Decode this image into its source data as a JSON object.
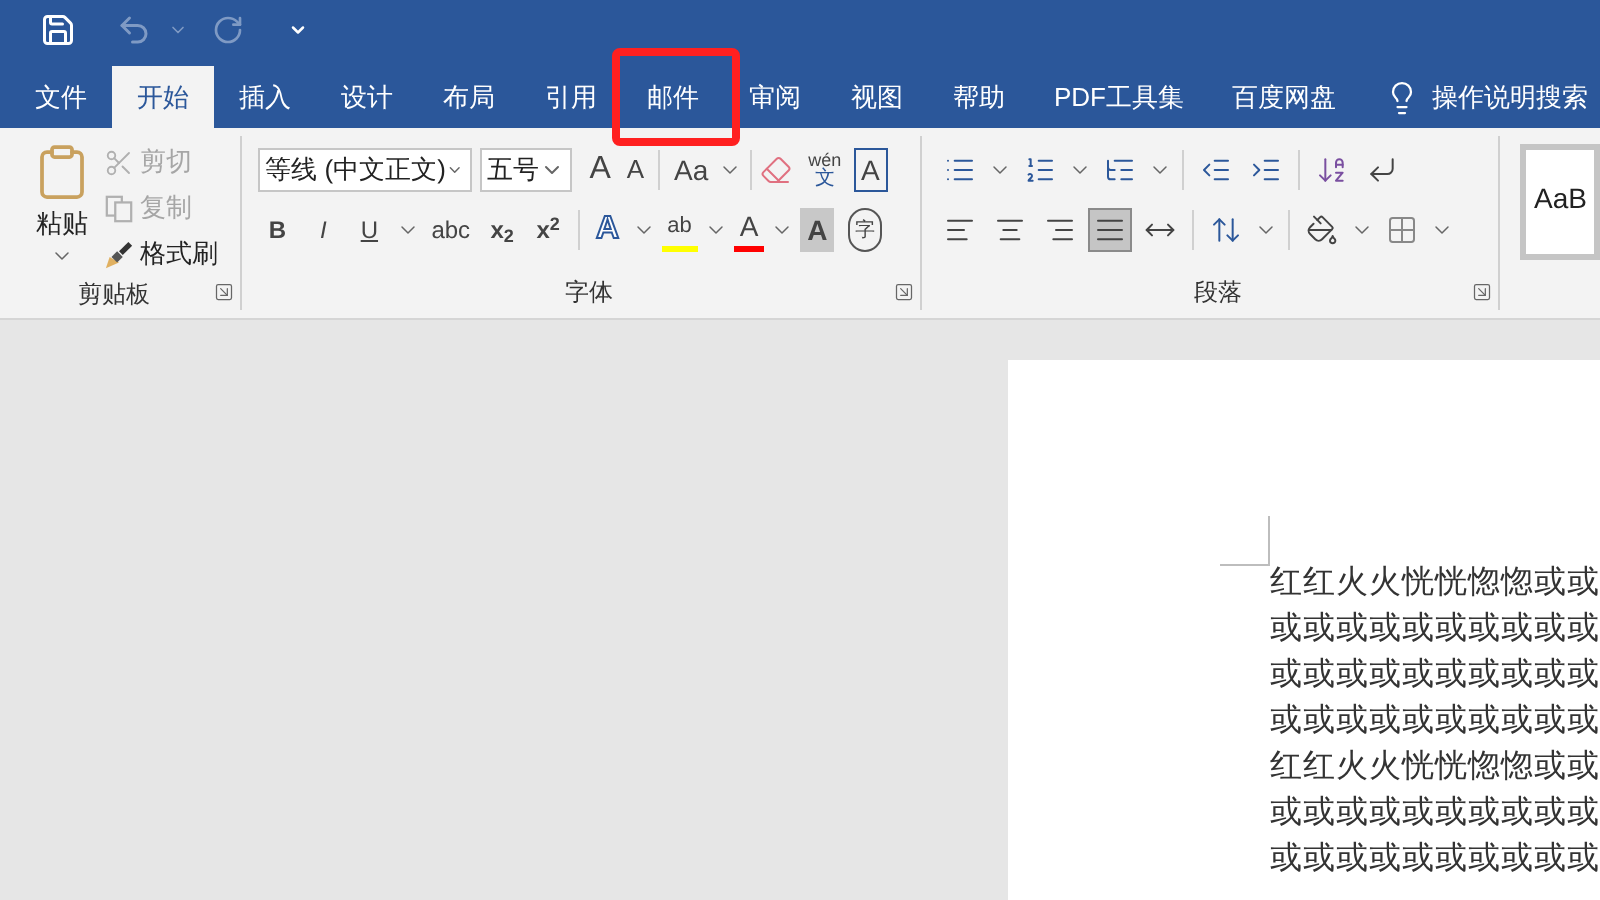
{
  "tabs": [
    {
      "label": "文件",
      "selected": false
    },
    {
      "label": "开始",
      "selected": true
    },
    {
      "label": "插入",
      "selected": false
    },
    {
      "label": "设计",
      "selected": false
    },
    {
      "label": "布局",
      "selected": false
    },
    {
      "label": "引用",
      "selected": false
    },
    {
      "label": "邮件",
      "selected": false
    },
    {
      "label": "审阅",
      "selected": false
    },
    {
      "label": "视图",
      "selected": false
    },
    {
      "label": "帮助",
      "selected": false
    },
    {
      "label": "PDF工具集",
      "selected": false
    },
    {
      "label": "百度网盘",
      "selected": false
    }
  ],
  "search": {
    "label": "操作说明搜索"
  },
  "clipboard": {
    "paste": "粘贴",
    "cut": {
      "label": "剪切",
      "disabled": true
    },
    "copy": {
      "label": "复制",
      "disabled": true
    },
    "format_painter": {
      "label": "格式刷",
      "disabled": false
    },
    "group_label": "剪贴板"
  },
  "font": {
    "font_name": "等线 (中文正文)",
    "font_size": "五号",
    "grow": "A",
    "shrink": "A",
    "change_case": "Aa",
    "phonetic_top": "wén",
    "phonetic_bottom": "文",
    "char_border": "A",
    "format_buttons": [
      "B",
      "I",
      "U",
      "abc",
      "x$_{2}$",
      "x$^{2}$"
    ],
    "text_effect": "A",
    "highlight": "ab",
    "font_color": "A",
    "shading": "A",
    "enclosed": "字",
    "group_label": "字体"
  },
  "paragraph": {
    "alignments": [
      {
        "selected": false
      },
      {
        "selected": false
      },
      {
        "selected": false
      },
      {
        "selected": true
      },
      {
        "selected": false
      }
    ],
    "group_label": "段落"
  },
  "styles": {
    "preview": "AaB"
  },
  "document": {
    "lines": [
      "红红火火恍恍惚惚或或",
      "或或或或或或或或或或",
      "或或或或或或或或或或",
      "或或或或或或或或或或",
      "红红火火恍恍惚惚或或",
      "或或或或或或或或或或",
      "或或或或或或或或或或"
    ]
  }
}
